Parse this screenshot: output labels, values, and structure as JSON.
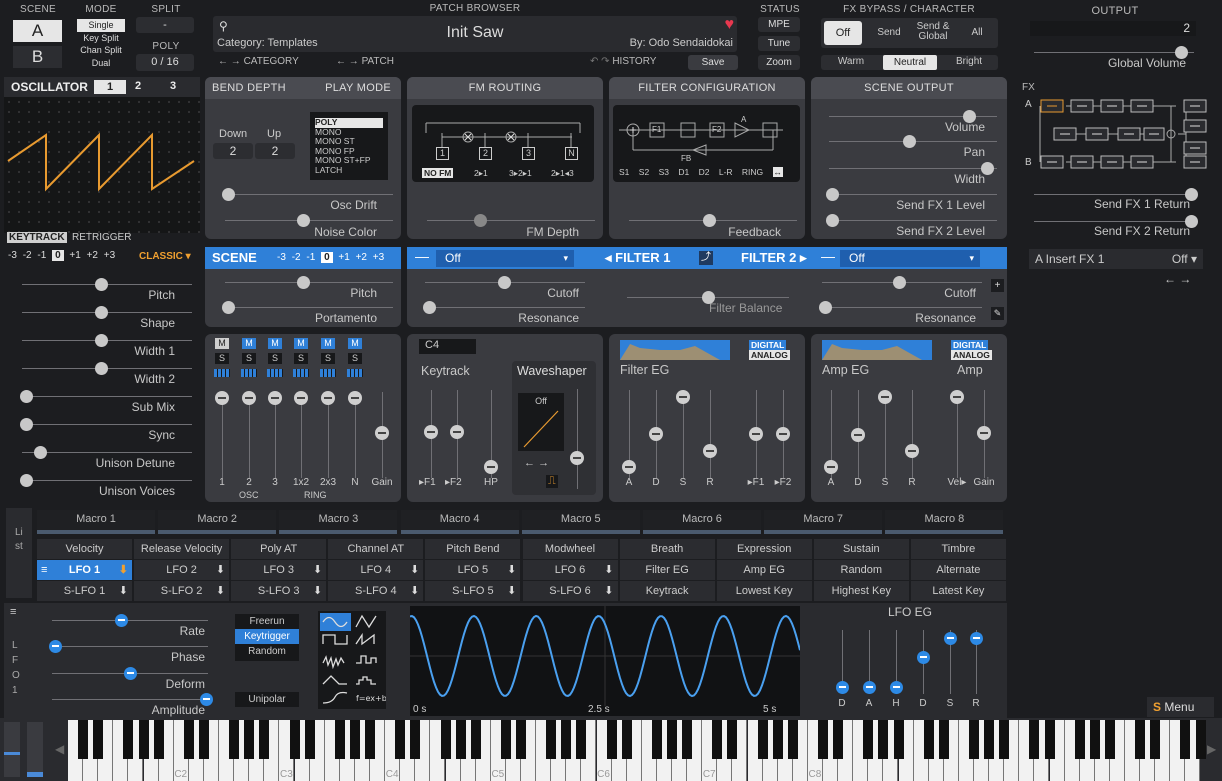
{
  "scene": {
    "title": "SCENE",
    "a": "A",
    "b": "B"
  },
  "mode": {
    "title": "MODE",
    "items": [
      "Single",
      "Key Split",
      "Chan Split",
      "Dual"
    ]
  },
  "split": {
    "title": "SPLIT",
    "value": "-"
  },
  "poly": {
    "title": "POLY",
    "value": "0 / 16"
  },
  "browser": {
    "title": "PATCH BROWSER",
    "patch": "Init Saw",
    "category": "Category: Templates",
    "author": "By: Odo Sendaidokai",
    "category_label": "CATEGORY",
    "patch_label": "PATCH",
    "history_label": "HISTORY",
    "save": "Save"
  },
  "status": {
    "title": "STATUS",
    "mpe": "MPE",
    "tune": "Tune",
    "zoom": "Zoom"
  },
  "fxbypass": {
    "title": "FX BYPASS / CHARACTER",
    "off": "Off",
    "send": "Send",
    "sendglobal": "Send & Global",
    "all": "All",
    "warm": "Warm",
    "neutral": "Neutral",
    "bright": "Bright"
  },
  "output": {
    "title": "OUTPUT",
    "value": "2",
    "global_volume": "Global Volume",
    "fx": "FX",
    "a": "A",
    "b": "B",
    "send1": "Send FX 1 Return",
    "send2": "Send FX 2 Return",
    "insert": "A Insert FX 1",
    "insert_val": "Off ▾"
  },
  "osc": {
    "title": "OSCILLATOR",
    "tabs": [
      "1",
      "2",
      "3"
    ],
    "keytrack": "KEYTRACK",
    "retrigger": "RETRIGGER",
    "octaves": [
      "-3",
      "-2",
      "-1",
      "0",
      "+1",
      "+2",
      "+3"
    ],
    "classic": "CLASSIC ▾",
    "params": [
      "Pitch",
      "Shape",
      "Width 1",
      "Width 2",
      "Sub Mix",
      "Sync",
      "Unison Detune",
      "Unison Voices"
    ]
  },
  "bend": {
    "title": "BEND DEPTH",
    "down": "Down",
    "up": "Up",
    "down_val": "2",
    "up_val": "2",
    "osc_drift": "Osc Drift",
    "noise": "Noise Color"
  },
  "play": {
    "title": "PLAY MODE",
    "items": [
      "POLY",
      "MONO",
      "MONO ST",
      "MONO FP",
      "MONO ST+FP",
      "LATCH"
    ]
  },
  "fm": {
    "title": "FM ROUTING",
    "nodes": [
      "1",
      "2",
      "3",
      "N"
    ],
    "buttons": [
      "NO FM",
      "2▸1",
      "3▸2▸1",
      "2▸1◂3"
    ],
    "depth": "FM Depth"
  },
  "filtcfg": {
    "title": "FILTER CONFIGURATION",
    "buttons": [
      "S1",
      "S2",
      "S3",
      "D1",
      "D2",
      "L-R",
      "RING"
    ],
    "feedback": "Feedback",
    "a": "A",
    "fb": "FB",
    "f1": "F1",
    "f2": "F2"
  },
  "sceneout": {
    "title": "SCENE OUTPUT",
    "labels": [
      "Volume",
      "Pan",
      "Width",
      "Send FX 1 Level",
      "Send FX 2 Level"
    ]
  },
  "scenebar": {
    "title": "SCENE",
    "octaves": [
      "-3",
      "-2",
      "-1",
      "0",
      "+1",
      "+2",
      "+3"
    ],
    "pitch": "Pitch",
    "portamento": "Portamento"
  },
  "filterbar": {
    "off1": "Off",
    "f1": "◂ FILTER 1",
    "f2": "FILTER 2 ▸",
    "off2": "Off",
    "cutoff": "Cutoff",
    "resonance": "Resonance",
    "balance": "Filter Balance"
  },
  "mixer": {
    "m": "M",
    "s": "S",
    "labels": [
      "1",
      "2",
      "3",
      "1x2",
      "2x3",
      "N",
      "Gain"
    ],
    "osc": "OSC",
    "ring": "RING"
  },
  "keytrack": {
    "note": "C4",
    "title": "Keytrack",
    "ws": "Waveshaper",
    "ws_off": "Off",
    "labels": [
      "▸F1",
      "▸F2",
      "HP"
    ]
  },
  "filtereg": {
    "title": "Filter EG",
    "digital": "DIGITAL",
    "analog": "ANALOG",
    "labels": [
      "A",
      "D",
      "S",
      "R",
      "▸F1",
      "▸F2"
    ]
  },
  "ampeg": {
    "title": "Amp EG",
    "amp": "Amp",
    "digital": "DIGITAL",
    "analog": "ANALOG",
    "labels": [
      "A",
      "D",
      "S",
      "R",
      "Vel▸",
      "Gain"
    ]
  },
  "list": "List",
  "macros": [
    "Macro 1",
    "Macro 2",
    "Macro 3",
    "Macro 4",
    "Macro 5",
    "Macro 6",
    "Macro 7",
    "Macro 8"
  ],
  "mods": {
    "row1": [
      "Velocity",
      "Release Velocity",
      "Poly AT",
      "Channel AT",
      "Pitch Bend",
      "Modwheel",
      "Breath",
      "Expression",
      "Sustain",
      "Timbre"
    ],
    "row2": [
      "LFO 1",
      "LFO 2",
      "LFO 3",
      "LFO 4",
      "LFO 5",
      "LFO 6",
      "Filter EG",
      "Amp EG",
      "Random",
      "Alternate"
    ],
    "row3": [
      "S-LFO 1",
      "S-LFO 2",
      "S-LFO 3",
      "S-LFO 4",
      "S-LFO 5",
      "S-LFO 6",
      "Keytrack",
      "Lowest Key",
      "Highest Key",
      "Latest Key"
    ]
  },
  "lfo": {
    "side": "LFO 1",
    "params": [
      "Rate",
      "Phase",
      "Deform",
      "Amplitude"
    ],
    "freerun": "Freerun",
    "keytrigger": "Keytrigger",
    "random": "Random",
    "unipolar": "Unipolar",
    "t0": "0 s",
    "t1": "2.5 s",
    "t2": "5 s",
    "eg": "LFO EG",
    "eg_labels": [
      "D",
      "A",
      "H",
      "D",
      "S",
      "R"
    ],
    "menu": "Menu"
  },
  "keys": [
    "C2",
    "C3",
    "C4",
    "C5",
    "C6",
    "C7",
    "C8"
  ],
  "colors": {
    "accent": "#2f80d8",
    "orange": "#f0a030"
  }
}
